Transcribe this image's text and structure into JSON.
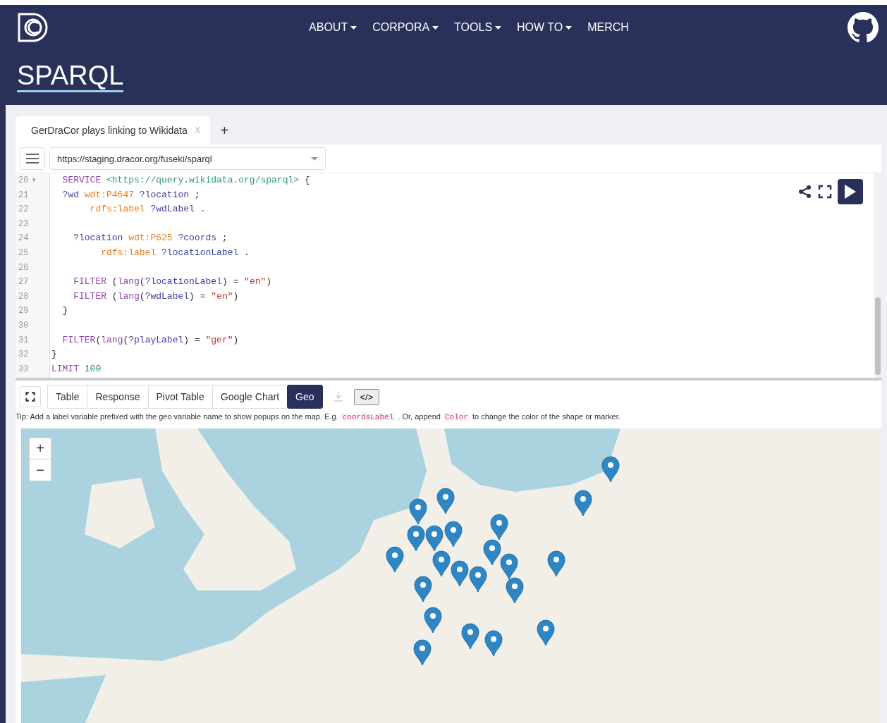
{
  "nav": {
    "items": [
      {
        "label": "ABOUT",
        "caret": true
      },
      {
        "label": "CORPORA",
        "caret": true
      },
      {
        "label": "TOOLS",
        "caret": true
      },
      {
        "label": "HOW TO",
        "caret": true
      },
      {
        "label": "MERCH",
        "caret": false
      }
    ]
  },
  "page_title": "SPARQL",
  "query_tabs": [
    {
      "label": "GerDraCor plays linking to Wikidata",
      "close": "X",
      "selected": true
    }
  ],
  "add_tab": "+",
  "endpoint": {
    "value": "https://staging.dracor.org/fuseki/sparql"
  },
  "editor": {
    "lines": [
      {
        "number": "20",
        "fold": "▾",
        "tokens": [
          {
            "t": "  SERVICE ",
            "kind": "kw"
          },
          {
            "t": "<https://query.wikidata.org/sparql>",
            "kind": "iri"
          },
          {
            "t": " {",
            "kind": "plain"
          }
        ]
      },
      {
        "number": "21",
        "tokens": [
          {
            "t": "  ?wd ",
            "kind": "var"
          },
          {
            "t": "wdt:P4647 ",
            "kind": "pn"
          },
          {
            "t": "?location",
            "kind": "var"
          },
          {
            "t": " ;",
            "kind": "plain"
          }
        ]
      },
      {
        "number": "22",
        "tokens": [
          {
            "t": "       rdfs:label ",
            "kind": "pn"
          },
          {
            "t": "?wdLabel",
            "kind": "var"
          },
          {
            "t": " .",
            "kind": "plain"
          }
        ]
      },
      {
        "number": "23"
      },
      {
        "number": "24",
        "tokens": [
          {
            "t": "    ?location ",
            "kind": "var"
          },
          {
            "t": "wdt:P625 ",
            "kind": "pn"
          },
          {
            "t": "?coords",
            "kind": "var"
          },
          {
            "t": " ;",
            "kind": "plain"
          }
        ]
      },
      {
        "number": "25",
        "tokens": [
          {
            "t": "         rdfs:label ",
            "kind": "pn"
          },
          {
            "t": "?locationLabel",
            "kind": "var"
          },
          {
            "t": " .",
            "kind": "plain"
          }
        ]
      },
      {
        "number": "26"
      },
      {
        "number": "27",
        "tokens": [
          {
            "t": "    FILTER",
            "kind": "kw"
          },
          {
            "t": " (",
            "kind": "plain"
          },
          {
            "t": "lang",
            "kind": "kw"
          },
          {
            "t": "(",
            "kind": "plain"
          },
          {
            "t": "?locationLabel",
            "kind": "var"
          },
          {
            "t": ") = ",
            "kind": "plain"
          },
          {
            "t": "\"en\"",
            "kind": "str"
          },
          {
            "t": ")",
            "kind": "plain"
          }
        ]
      },
      {
        "number": "28",
        "tokens": [
          {
            "t": "    FILTER",
            "kind": "kw"
          },
          {
            "t": " (",
            "kind": "plain"
          },
          {
            "t": "lang",
            "kind": "kw"
          },
          {
            "t": "(",
            "kind": "plain"
          },
          {
            "t": "?wdLabel",
            "kind": "var"
          },
          {
            "t": ") = ",
            "kind": "plain"
          },
          {
            "t": "\"en\"",
            "kind": "str"
          },
          {
            "t": ")",
            "kind": "plain"
          }
        ]
      },
      {
        "number": "29",
        "tokens": [
          {
            "t": "  }",
            "kind": "plain"
          }
        ]
      },
      {
        "number": "30"
      },
      {
        "number": "31",
        "tokens": [
          {
            "t": "  FILTER",
            "kind": "kw"
          },
          {
            "t": "(",
            "kind": "plain"
          },
          {
            "t": "lang",
            "kind": "kw"
          },
          {
            "t": "(",
            "kind": "plain"
          },
          {
            "t": "?playLabel",
            "kind": "var"
          },
          {
            "t": ") = ",
            "kind": "plain"
          },
          {
            "t": "\"ger\"",
            "kind": "str"
          },
          {
            "t": ")",
            "kind": "plain"
          }
        ]
      },
      {
        "number": "32",
        "tokens": [
          {
            "t": "}",
            "kind": "plain"
          }
        ]
      },
      {
        "number": "33",
        "tokens": [
          {
            "t": "LIMIT ",
            "kind": "kw"
          },
          {
            "t": "100",
            "kind": "num"
          }
        ]
      }
    ]
  },
  "result_tabs": [
    {
      "label": "Table",
      "selected": false
    },
    {
      "label": "Response",
      "selected": false
    },
    {
      "label": "Pivot Table",
      "selected": false
    },
    {
      "label": "Google Chart",
      "selected": false
    },
    {
      "label": "Geo",
      "selected": true
    }
  ],
  "download": {
    "disabled": true
  },
  "code_button": "</>",
  "tip": [
    {
      "kind": "text",
      "text": "Tip: Add a label variable prefixed with the geo variable name to show popups on the map. E.g. "
    },
    {
      "kind": "code",
      "text": "coordsLabel"
    },
    {
      "kind": "text",
      "text": " . Or, append "
    },
    {
      "kind": "code",
      "text": "Color"
    },
    {
      "kind": "text",
      "text": " to change the color of the shape or marker."
    }
  ],
  "map": {
    "zoom_in": "+",
    "zoom_out": "−"
  }
}
